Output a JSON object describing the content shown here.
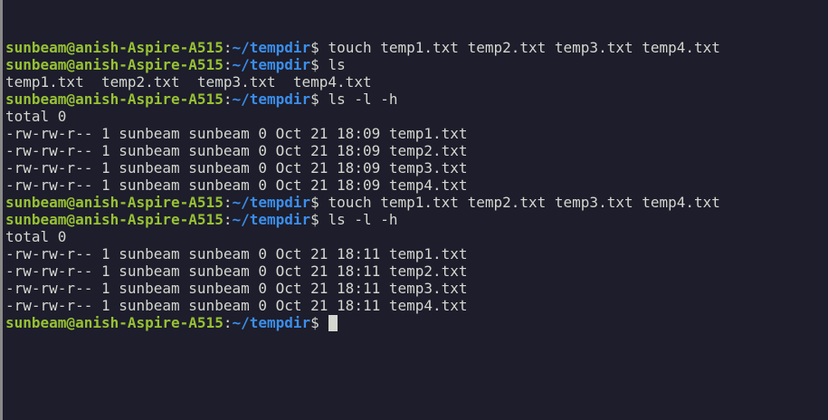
{
  "prompt": {
    "user_host": "sunbeam@anish-Aspire-A515",
    "colon": ":",
    "path": "~/tempdir",
    "symbol": "$"
  },
  "lines": [
    {
      "type": "prompt",
      "command": " touch temp1.txt temp2.txt temp3.txt temp4.txt"
    },
    {
      "type": "prompt",
      "command": " ls"
    },
    {
      "type": "output",
      "text": "temp1.txt  temp2.txt  temp3.txt  temp4.txt"
    },
    {
      "type": "prompt",
      "command": " ls -l -h"
    },
    {
      "type": "output",
      "text": "total 0"
    },
    {
      "type": "output",
      "text": "-rw-rw-r-- 1 sunbeam sunbeam 0 Oct 21 18:09 temp1.txt"
    },
    {
      "type": "output",
      "text": "-rw-rw-r-- 1 sunbeam sunbeam 0 Oct 21 18:09 temp2.txt"
    },
    {
      "type": "output",
      "text": "-rw-rw-r-- 1 sunbeam sunbeam 0 Oct 21 18:09 temp3.txt"
    },
    {
      "type": "output",
      "text": "-rw-rw-r-- 1 sunbeam sunbeam 0 Oct 21 18:09 temp4.txt"
    },
    {
      "type": "prompt",
      "command": " touch temp1.txt temp2.txt temp3.txt temp4.txt"
    },
    {
      "type": "prompt",
      "command": " ls -l -h"
    },
    {
      "type": "output",
      "text": "total 0"
    },
    {
      "type": "output",
      "text": "-rw-rw-r-- 1 sunbeam sunbeam 0 Oct 21 18:11 temp1.txt"
    },
    {
      "type": "output",
      "text": "-rw-rw-r-- 1 sunbeam sunbeam 0 Oct 21 18:11 temp2.txt"
    },
    {
      "type": "output",
      "text": "-rw-rw-r-- 1 sunbeam sunbeam 0 Oct 21 18:11 temp3.txt"
    },
    {
      "type": "output",
      "text": "-rw-rw-r-- 1 sunbeam sunbeam 0 Oct 21 18:11 temp4.txt"
    },
    {
      "type": "active_prompt",
      "command": " "
    }
  ],
  "colors": {
    "background": "#1d1d2b",
    "user_host": "#97c233",
    "path": "#3b8eea",
    "text": "#d3d7cf"
  }
}
